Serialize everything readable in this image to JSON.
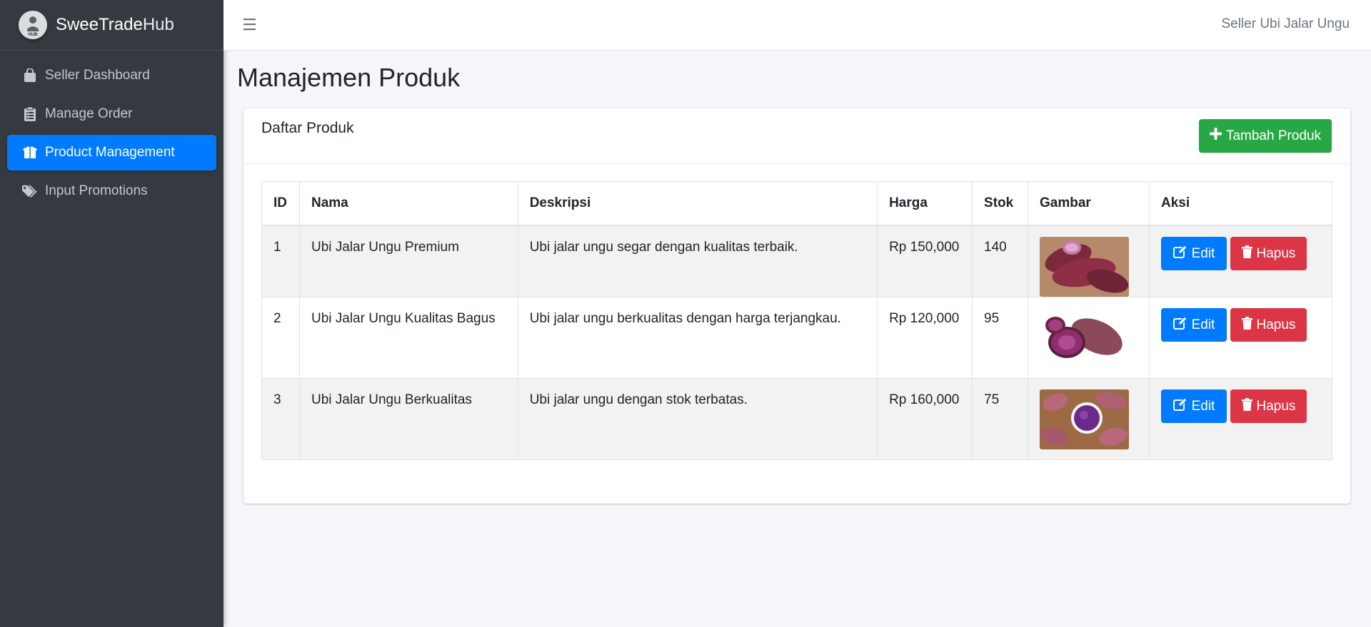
{
  "brand": {
    "name_bold": "SweeTrade",
    "name_light": "Hub",
    "logo_label": "HUB"
  },
  "sidebar": {
    "items": [
      {
        "label": "Seller Dashboard",
        "icon": "shopping-bag-icon",
        "active": false
      },
      {
        "label": "Manage Order",
        "icon": "clipboard-list-icon",
        "active": false
      },
      {
        "label": "Product Management",
        "icon": "box-open-icon",
        "active": true
      },
      {
        "label": "Input Promotions",
        "icon": "tags-icon",
        "active": false
      }
    ]
  },
  "topbar": {
    "menu_icon": "hamburger-icon",
    "user": "Seller Ubi Jalar Ungu"
  },
  "page": {
    "title": "Manajemen Produk"
  },
  "card": {
    "title": "Daftar Produk",
    "add_button": "Tambah Produk"
  },
  "table": {
    "headers": [
      "ID",
      "Nama",
      "Deskripsi",
      "Harga",
      "Stok",
      "Gambar",
      "Aksi"
    ],
    "rows": [
      {
        "id": "1",
        "name": "Ubi Jalar Ungu Premium",
        "desc": "Ubi jalar ungu segar dengan kualitas terbaik.",
        "price": "Rp 150,000",
        "stock": "140",
        "edit": "Edit",
        "delete": "Hapus"
      },
      {
        "id": "2",
        "name": "Ubi Jalar Ungu Kualitas Bagus",
        "desc": "Ubi jalar ungu berkualitas dengan harga terjangkau.",
        "price": "Rp 120,000",
        "stock": "95",
        "edit": "Edit",
        "delete": "Hapus"
      },
      {
        "id": "3",
        "name": "Ubi Jalar Ungu Berkualitas",
        "desc": "Ubi jalar ungu dengan stok terbatas.",
        "price": "Rp 160,000",
        "stock": "75",
        "edit": "Edit",
        "delete": "Hapus"
      }
    ]
  },
  "colors": {
    "sidebar": "#343a40",
    "primary": "#007bff",
    "success": "#28a745",
    "danger": "#dc3545"
  }
}
